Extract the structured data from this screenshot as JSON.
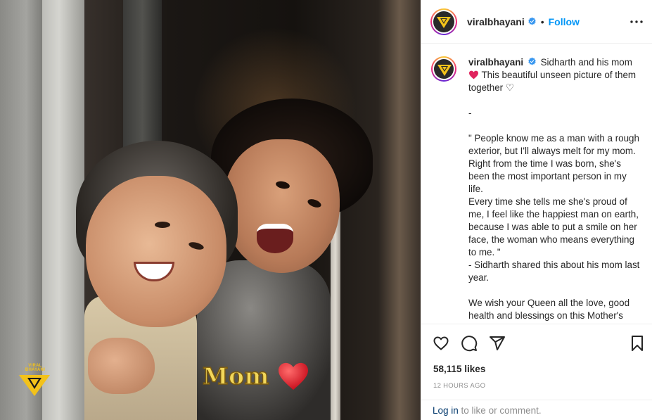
{
  "media": {
    "overlay_caption": "Mom",
    "watermark_text": "VIRAL BHAYANI"
  },
  "header": {
    "username": "viralbhayani",
    "separator": "•",
    "follow_label": "Follow"
  },
  "caption": {
    "username": "viralbhayani",
    "line1": "Sidharth and his mom",
    "line2": " This beautiful unseen picture of them together ♡",
    "body": "\n-\n\n\" People know me as a man with a rough exterior, but I'll always melt for my mom. Right from the time I was born, she's been the most important person in my life.\nEvery time she tells me she's proud of me, I feel like the happiest man on earth, because I was able to put a smile on her face, the woman who means everything to me. \"\n- Sidharth shared this about his mom last year.\n\nWe wish your Queen all the love, good health and blessings on this Mother's"
  },
  "actions": {
    "likes": "58,115 likes",
    "timestamp": "12 HOURS AGO"
  },
  "footer": {
    "login_link": "Log in",
    "login_suffix": " to like or comment."
  },
  "colors": {
    "accent_blue": "#0095f6",
    "link_dark": "#00376b",
    "muted": "#8e8e8e",
    "heart_red": "#e0245e"
  },
  "icons": [
    "heart-icon",
    "comment-icon",
    "share-icon",
    "bookmark-icon",
    "more-icon",
    "verified-icon"
  ]
}
